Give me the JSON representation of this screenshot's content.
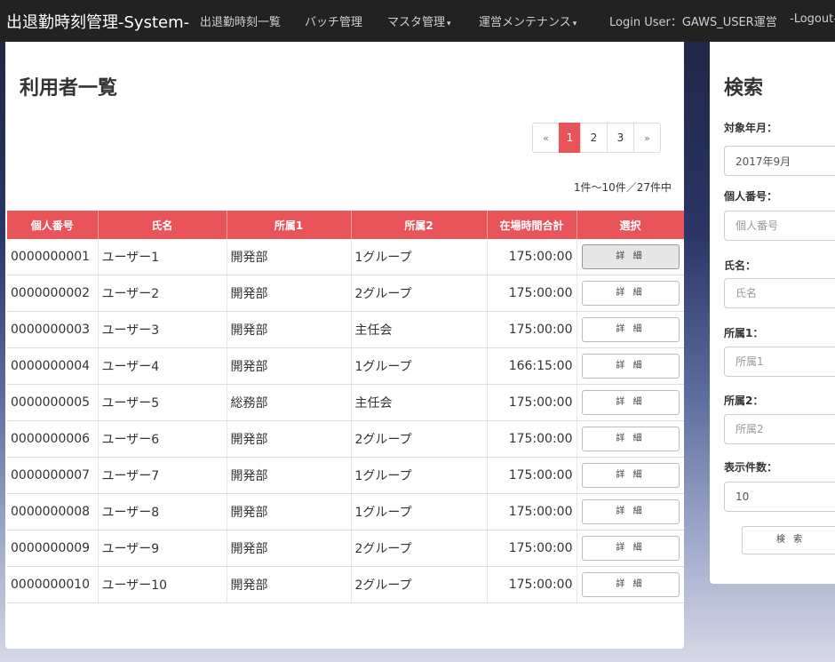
{
  "navbar": {
    "brand": "出退勤時刻管理-System-",
    "items": [
      {
        "label": "出退勤時刻一覧"
      },
      {
        "label": "バッチ管理"
      },
      {
        "label": "マスタ管理"
      },
      {
        "label": "運営メンテナンス"
      }
    ],
    "caret": "▾",
    "login": "Login User：GAWS_USER運営",
    "logout": "-Logout-"
  },
  "main": {
    "title": "利用者一覧",
    "pagination": {
      "prev": "«",
      "pages": [
        "1",
        "2",
        "3"
      ],
      "current": "1",
      "next": "»"
    },
    "count_text": "1件～10件／27件中",
    "table": {
      "headers": [
        "個人番号",
        "氏名",
        "所属1",
        "所属2",
        "在場時間合計",
        "選択"
      ],
      "rows": [
        {
          "id": "0000000001",
          "name": "ユーザー1",
          "dept1": "開発部",
          "dept2": "1グループ",
          "total": "175:00:00",
          "action": "詳 細"
        },
        {
          "id": "0000000002",
          "name": "ユーザー2",
          "dept1": "開発部",
          "dept2": "2グループ",
          "total": "175:00:00",
          "action": "詳 細"
        },
        {
          "id": "0000000003",
          "name": "ユーザー3",
          "dept1": "開発部",
          "dept2": "主任会",
          "total": "175:00:00",
          "action": "詳 細"
        },
        {
          "id": "0000000004",
          "name": "ユーザー4",
          "dept1": "開発部",
          "dept2": "1グループ",
          "total": "166:15:00",
          "action": "詳 細"
        },
        {
          "id": "0000000005",
          "name": "ユーザー5",
          "dept1": "総務部",
          "dept2": "主任会",
          "total": "175:00:00",
          "action": "詳 細"
        },
        {
          "id": "0000000006",
          "name": "ユーザー6",
          "dept1": "開発部",
          "dept2": "2グループ",
          "total": "175:00:00",
          "action": "詳 細"
        },
        {
          "id": "0000000007",
          "name": "ユーザー7",
          "dept1": "開発部",
          "dept2": "1グループ",
          "total": "175:00:00",
          "action": "詳 細"
        },
        {
          "id": "0000000008",
          "name": "ユーザー8",
          "dept1": "開発部",
          "dept2": "1グループ",
          "total": "175:00:00",
          "action": "詳 細"
        },
        {
          "id": "0000000009",
          "name": "ユーザー9",
          "dept1": "開発部",
          "dept2": "2グループ",
          "total": "175:00:00",
          "action": "詳 細"
        },
        {
          "id": "0000000010",
          "name": "ユーザー10",
          "dept1": "開発部",
          "dept2": "2グループ",
          "total": "175:00:00",
          "action": "詳 細"
        }
      ]
    }
  },
  "search": {
    "title": "検索",
    "year_month_label": "対象年月：",
    "year_month_value": "2017年9月",
    "personal_id_label": "個人番号：",
    "personal_id_placeholder": "個人番号",
    "name_label": "氏名：",
    "name_placeholder": "氏名",
    "dept1_label": "所属1：",
    "dept1_placeholder": "所属1",
    "dept2_label": "所属2：",
    "dept2_placeholder": "所属2",
    "display_count_label": "表示件数：",
    "display_count_value": "10",
    "button": "検 索"
  },
  "colors": {
    "navbar_bg": "#222222",
    "accent": "#e8545a",
    "panel_bg": "#ffffff"
  }
}
